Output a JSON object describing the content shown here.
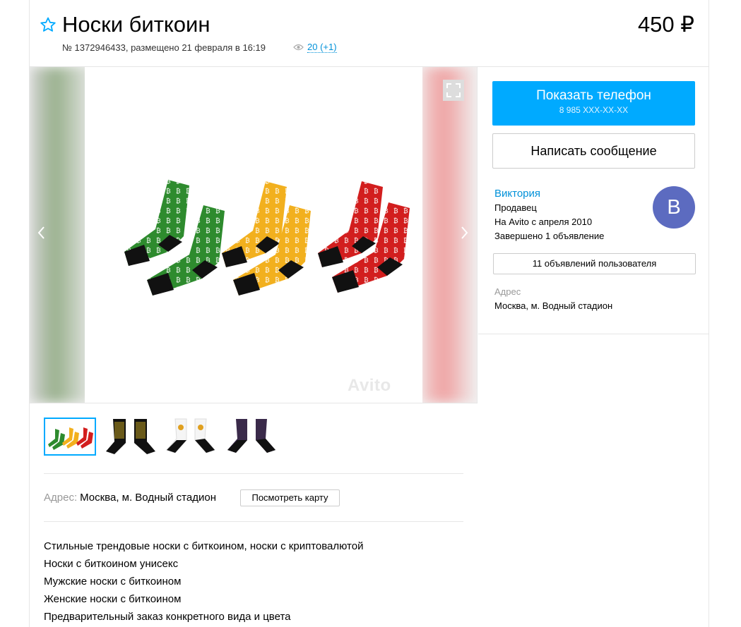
{
  "listing": {
    "title": "Носки биткоин",
    "price": "450 ₽",
    "meta": "№ 1372946433, размещено 21 февраля в 16:19",
    "views": "20 (+1)"
  },
  "gallery": {
    "prev_icon": "chevron-left-icon",
    "next_icon": "chevron-right-icon",
    "fullscreen_icon": "fullscreen-icon",
    "watermark": "Avito",
    "thumbnails": [
      "thumb-socks-colors",
      "thumb-socks-black-gold",
      "thumb-socks-white",
      "thumb-socks-purple"
    ]
  },
  "address_row": {
    "label": "Адрес:",
    "value": "Москва, м. Водный стадион",
    "map_button": "Посмотреть карту"
  },
  "description": [
    "Стильные трендовые носки с биткоином, носки с криптовалютой",
    "Носки с биткоином унисекс",
    "Мужские носки с биткоином",
    "Женские носки с биткоином",
    "Предварительный заказ конкретного вида и цвета"
  ],
  "sidebar": {
    "phone_button": "Показать телефон",
    "phone_masked": "8 985 XXX-XX-XX",
    "message_button": "Написать сообщение",
    "seller": {
      "name": "Виктория",
      "role": "Продавец",
      "since": "На Avito с апреля 2010",
      "completed": "Завершено 1 объявление",
      "avatar_letter": "В"
    },
    "all_ads_button": "11 объявлений пользователя",
    "address_label": "Адрес",
    "address": "Москва, м. Водный стадион"
  },
  "colors": {
    "accent": "#00aaff",
    "link": "#0091d9",
    "avatar": "#5c6bc0",
    "sock_green": "#2e8b2e",
    "sock_yellow": "#f2b01e",
    "sock_red": "#d21e1e"
  }
}
